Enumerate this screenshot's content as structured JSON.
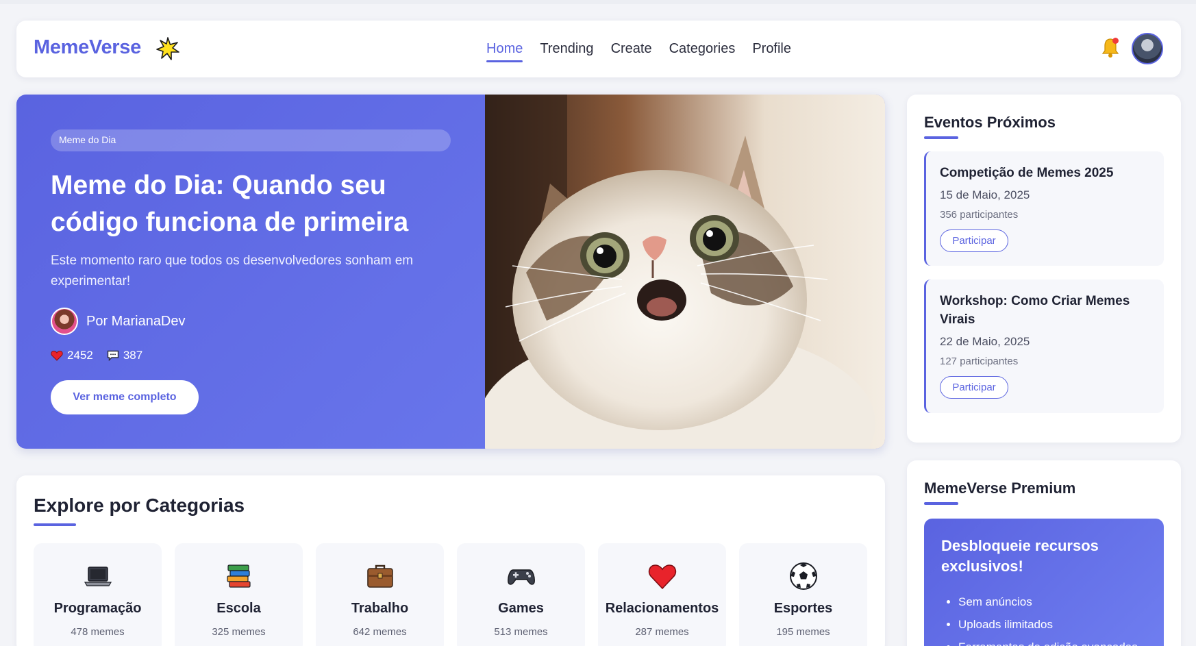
{
  "brand": {
    "name": "MemeVerse",
    "star_icon": "sparkle-star-icon"
  },
  "nav": {
    "items": [
      {
        "label": "Home",
        "active": true
      },
      {
        "label": "Trending",
        "active": false
      },
      {
        "label": "Create",
        "active": false
      },
      {
        "label": "Categories",
        "active": false
      },
      {
        "label": "Profile",
        "active": false
      }
    ]
  },
  "hero": {
    "badge": "Meme do Dia",
    "title": "Meme do Dia: Quando seu código funciona de primeira",
    "subtitle": "Este momento raro que todos os desenvolvedores sonham em experimentar!",
    "author": "Por MarianaDev",
    "likes": "2452",
    "comments": "387",
    "button": "Ver meme completo"
  },
  "categories": {
    "title": "Explore por Categorias",
    "items": [
      {
        "name": "Programação",
        "count": "478 memes",
        "icon": "laptop-icon"
      },
      {
        "name": "Escola",
        "count": "325 memes",
        "icon": "books-icon"
      },
      {
        "name": "Trabalho",
        "count": "642 memes",
        "icon": "briefcase-icon"
      },
      {
        "name": "Games",
        "count": "513 memes",
        "icon": "gamepad-icon"
      },
      {
        "name": "Relacionamentos",
        "count": "287 memes",
        "icon": "heart-icon"
      },
      {
        "name": "Esportes",
        "count": "195 memes",
        "icon": "soccer-ball-icon"
      }
    ]
  },
  "events": {
    "title": "Eventos Próximos",
    "items": [
      {
        "name": "Competição de Memes 2025",
        "date": "15 de Maio, 2025",
        "participants": "356 participantes",
        "button": "Participar"
      },
      {
        "name": "Workshop: Como Criar Memes Virais",
        "date": "22 de Maio, 2025",
        "participants": "127 participantes",
        "button": "Participar"
      }
    ]
  },
  "premium": {
    "title": "MemeVerse Premium",
    "headline": "Desbloqueie recursos exclusivos!",
    "features": [
      "Sem anúncios",
      "Uploads ilimitados",
      "Ferramentas de edição avançadas"
    ]
  },
  "colors": {
    "accent": "#5a63e0",
    "accent_light": "#6f7ef0",
    "notification": "#ef3b3b"
  }
}
